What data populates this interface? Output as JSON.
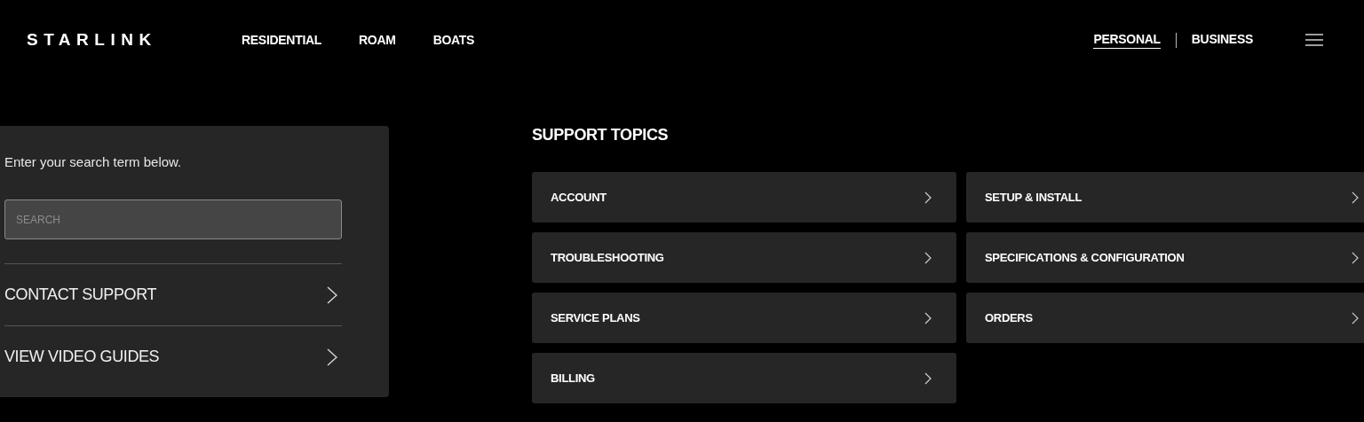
{
  "header": {
    "logo": "STARLINK",
    "nav": [
      "RESIDENTIAL",
      "ROAM",
      "BOATS"
    ],
    "segments": [
      {
        "label": "PERSONAL",
        "selected": true
      },
      {
        "label": "BUSINESS",
        "selected": false
      }
    ]
  },
  "search_panel": {
    "intro": "Enter your search term below.",
    "search": {
      "placeholder": "SEARCH"
    },
    "links": [
      "CONTACT SUPPORT",
      "VIEW VIDEO GUIDES"
    ]
  },
  "support_topics": {
    "title": "SUPPORT TOPICS",
    "topics": [
      "ACCOUNT",
      "SETUP & INSTALL",
      "TROUBLESHOOTING",
      "SPECIFICATIONS & CONFIGURATION",
      "SERVICE PLANS",
      "ORDERS",
      "BILLING"
    ]
  }
}
